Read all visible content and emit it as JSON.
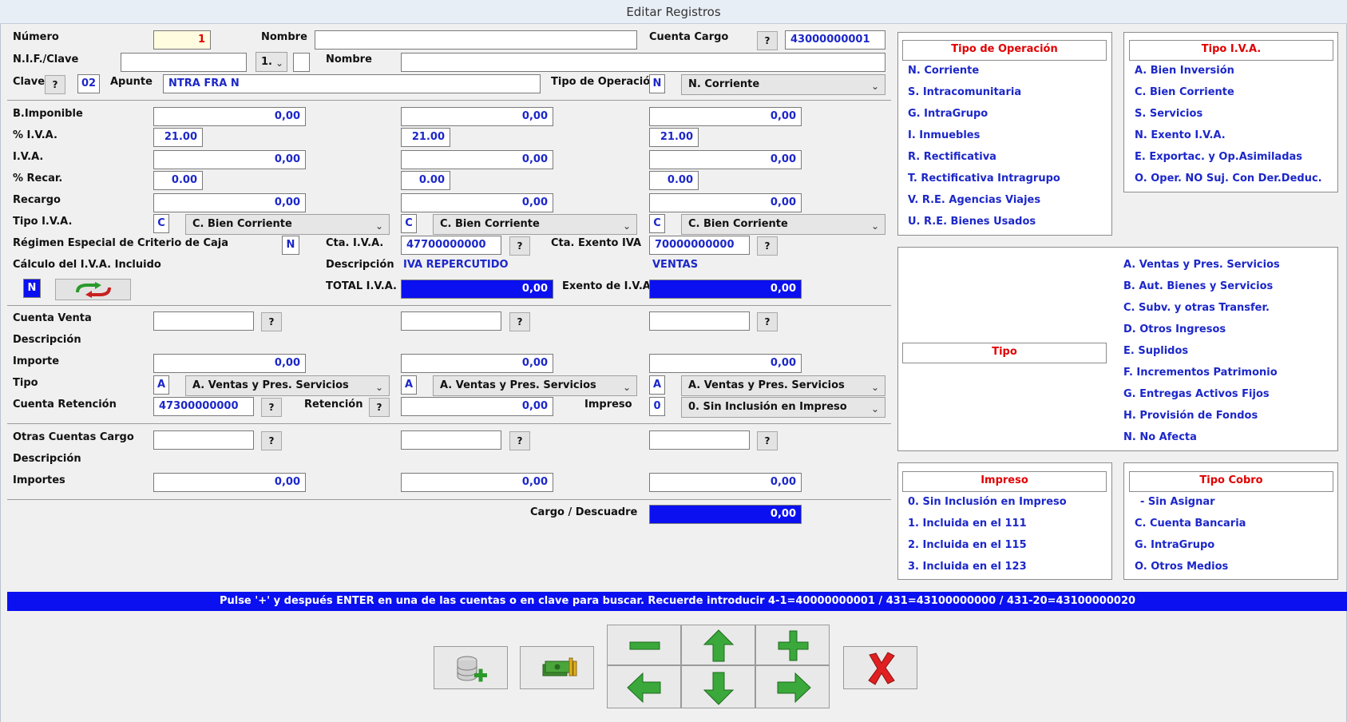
{
  "window": {
    "title": "Editar Registros"
  },
  "labels": {
    "numero": "Número",
    "nombre": "Nombre",
    "cuenta_cargo": "Cuenta Cargo",
    "nif": "N.I.F./Clave",
    "nombre2": "Nombre",
    "clave": "Clave",
    "apunte": "Apunte",
    "tipo_operacion": "Tipo de Operación",
    "b_imponible": "B.Imponible",
    "pct_iva": "% I.V.A.",
    "iva": "I.V.A.",
    "pct_recar": "% Recar.",
    "recargo": "Recargo",
    "tipo_iva": "Tipo I.V.A.",
    "regimen": "Régimen Especial de Criterio de Caja",
    "cta_iva": "Cta. I.V.A.",
    "cta_exento": "Cta. Exento IVA",
    "calculo": "Cálculo del I.V.A. Incluido",
    "descripcion": "Descripción",
    "total_iva": "TOTAL I.V.A.",
    "exento_iva": "Exento de I.V.A.",
    "cuenta_venta": "Cuenta Venta",
    "descripcion2": "Descripción",
    "importe": "Importe",
    "tipo": "Tipo",
    "cuenta_retencion": "Cuenta Retención",
    "retencion": "Retención",
    "impreso": "Impreso",
    "otras_cuentas": "Otras Cuentas Cargo",
    "descripcion3": "Descripción",
    "importes": "Importes",
    "cargo_descuadre": "Cargo / Descuadre"
  },
  "header": {
    "numero": "1",
    "nombre": "",
    "q": "?",
    "cuenta_cargo": "43000000001",
    "nif": "",
    "nif_sel": "1.",
    "nif_check": "",
    "nombre2": "",
    "clave": "02",
    "apunte": "NTRA  FRA N",
    "tipo_op_code": "N",
    "tipo_op_sel": "N. Corriente"
  },
  "iva": {
    "col1": {
      "base": "0,00",
      "pct": "21.00",
      "iva": "0,00",
      "recar": "0.00",
      "recargo": "0,00",
      "tcode": "C",
      "tsel": "C. Bien Corriente"
    },
    "col2": {
      "base": "0,00",
      "pct": "21.00",
      "iva": "0,00",
      "recar": "0.00",
      "recargo": "0,00",
      "tcode": "C",
      "tsel": "C. Bien Corriente"
    },
    "col3": {
      "base": "0,00",
      "pct": "21.00",
      "iva": "0,00",
      "recar": "0.00",
      "recargo": "0,00",
      "tcode": "C",
      "tsel": "C. Bien Corriente"
    },
    "regimen_code": "N",
    "cta_iva": "47700000000",
    "cta_exento": "70000000000",
    "desc_iva": "IVA REPERCUTIDO",
    "desc_exento": "VENTAS",
    "calculo_code": "N",
    "total_iva": "0,00",
    "exento": "0,00"
  },
  "ventas": {
    "col1": {
      "cuenta": "",
      "importe": "0,00",
      "tcode": "A",
      "tsel": "A. Ventas y Pres. Servicios"
    },
    "col2": {
      "cuenta": "",
      "importe": "0,00",
      "tcode": "A",
      "tsel": "A. Ventas y Pres. Servicios"
    },
    "col3": {
      "cuenta": "",
      "importe": "0,00",
      "tcode": "A",
      "tsel": "A. Ventas y Pres. Servicios"
    },
    "cuenta_retencion": "47300000000",
    "retencion": "0,00",
    "impreso_code": "0",
    "impreso_sel": "0. Sin Inclusión en Impreso"
  },
  "otras": {
    "c1": "",
    "c2": "",
    "c3": "",
    "i1": "0,00",
    "i2": "0,00",
    "i3": "0,00",
    "cargo": "0,00"
  },
  "panels": {
    "tipo_operacion": {
      "title": "Tipo de Operación",
      "items": [
        "N. Corriente",
        "S. Intracomunitaria",
        "G. IntraGrupo",
        "I. Inmuebles",
        "R. Rectificativa",
        "T. Rectificativa Intragrupo",
        "V. R.E. Agencias Viajes",
        "U. R.E. Bienes Usados"
      ]
    },
    "tipo_iva": {
      "title": "Tipo I.V.A.",
      "items": [
        "A. Bien Inversión",
        "C. Bien Corriente",
        "S. Servicios",
        "N. Exento I.V.A.",
        "E. Exportac. y Op.Asimiladas",
        "O. Oper. NO Suj. Con Der.Deduc."
      ]
    },
    "tipo": {
      "title": "Tipo",
      "items": [
        "A. Ventas y Pres. Servicios",
        "B. Aut. Bienes y Servicios",
        "C. Subv. y otras Transfer.",
        "D. Otros Ingresos",
        "E. Suplidos",
        "F. Incrementos Patrimonio",
        "G. Entregas Activos Fijos",
        "H. Provisión de Fondos",
        "N. No Afecta"
      ]
    },
    "impreso": {
      "title": "Impreso",
      "items": [
        "0. Sin Inclusión en Impreso",
        "1. Incluida en el 111",
        "2. Incluida en el 115",
        "3. Incluida en el 123"
      ]
    },
    "tipo_cobro": {
      "title": "Tipo Cobro",
      "items": [
        "- Sin Asignar",
        "C. Cuenta Bancaria",
        "G. IntraGrupo",
        "O. Otros Medios"
      ]
    }
  },
  "status": "Pulse '+' y después ENTER en una de las cuentas o en clave para buscar. Recuerde introducir 4-1=40000000001 / 431=43100000000 / 431-20=43100000020",
  "colors": {
    "accent": "#0a10f0",
    "value_text": "#1c27c9",
    "panel_title": "#e00000"
  }
}
